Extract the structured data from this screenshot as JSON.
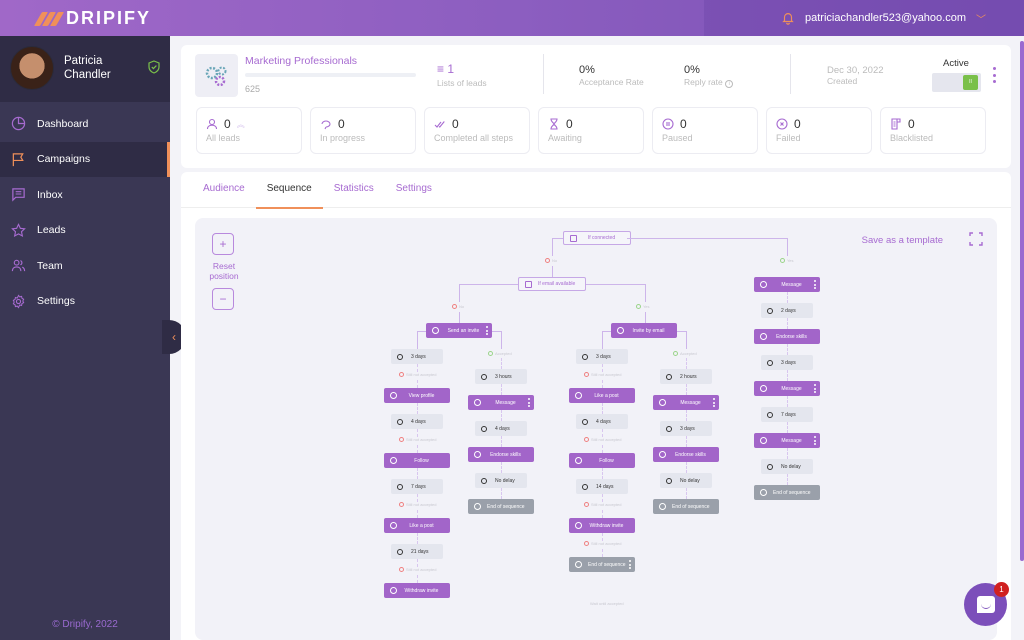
{
  "app": {
    "brand": "DRIPIFY"
  },
  "header": {
    "email": "patriciachandler523@yahoo.com",
    "icons": {
      "bell": "bell-icon",
      "chevron": "chevron-down-icon"
    }
  },
  "sidebar": {
    "user": {
      "first": "Patricia",
      "last": "Chandler"
    },
    "items": [
      {
        "label": "Dashboard",
        "icon": "pie-chart-icon"
      },
      {
        "label": "Campaigns",
        "icon": "flag-icon",
        "active": true
      },
      {
        "label": "Inbox",
        "icon": "message-icon"
      },
      {
        "label": "Leads",
        "icon": "star-icon"
      },
      {
        "label": "Team",
        "icon": "team-icon"
      },
      {
        "label": "Settings",
        "icon": "gear-icon"
      }
    ],
    "copyright": "© Dripify, 2022"
  },
  "campaign": {
    "name": "Marketing Professionals",
    "count": "625",
    "lists_value": "1",
    "lists_label": "Lists of leads",
    "acceptance_value": "0%",
    "acceptance_label": "Acceptance Rate",
    "reply_value": "0%",
    "reply_label": "Reply rate",
    "created_date": "Dec 30, 2022",
    "created_label": "Created",
    "status_label": "Active",
    "status_on": true
  },
  "stats": [
    {
      "value": "0",
      "label": "All leads",
      "icon": "user-icon"
    },
    {
      "value": "0",
      "label": "In progress",
      "icon": "progress-icon"
    },
    {
      "value": "0",
      "label": "Completed all steps",
      "icon": "double-check-icon"
    },
    {
      "value": "0",
      "label": "Awaiting",
      "icon": "hourglass-icon"
    },
    {
      "value": "0",
      "label": "Paused",
      "icon": "pause-icon"
    },
    {
      "value": "0",
      "label": "Failed",
      "icon": "x-circle-icon"
    },
    {
      "value": "0",
      "label": "Blacklisted",
      "icon": "blacklist-icon"
    }
  ],
  "tabs": [
    {
      "label": "Audience"
    },
    {
      "label": "Sequence",
      "active": true
    },
    {
      "label": "Statistics"
    },
    {
      "label": "Settings"
    }
  ],
  "canvas": {
    "zoom_in": "+",
    "zoom_out": "−",
    "reset": "Reset position",
    "save_template": "Save as a template"
  },
  "flow": {
    "if_connected": "If connected",
    "if_email": "If email available",
    "no": "No",
    "yes": "Yes",
    "accepted": "Accepted",
    "still_not_accepted": "Still not accepted",
    "wait_until_accepted": "Wait until accepted",
    "send_invite": "Send an invite",
    "invite_email": "Invite by email",
    "branch_a_left": [
      {
        "type": "delay",
        "text": "3 days"
      },
      {
        "type": "action",
        "text": "View profile",
        "icon": "eye-icon"
      },
      {
        "type": "delay",
        "text": "4 days"
      },
      {
        "type": "action",
        "text": "Follow",
        "icon": "follow-icon"
      },
      {
        "type": "delay",
        "text": "7 days"
      },
      {
        "type": "action",
        "text": "Like a post",
        "icon": "thumbs-up-icon"
      },
      {
        "type": "delay",
        "text": "21 days"
      },
      {
        "type": "action",
        "text": "Withdraw invite",
        "icon": "user-icon"
      }
    ],
    "branch_a_right": [
      {
        "type": "delay",
        "text": "3 hours"
      },
      {
        "type": "action",
        "text": "Message",
        "icon": "message-icon"
      },
      {
        "type": "delay",
        "text": "4 days"
      },
      {
        "type": "action",
        "text": "Endorse skills",
        "icon": "check-circle-icon"
      },
      {
        "type": "delay",
        "text": "No delay"
      },
      {
        "type": "end",
        "text": "End of sequence"
      }
    ],
    "branch_b_left": [
      {
        "type": "delay",
        "text": "3 days"
      },
      {
        "type": "action",
        "text": "Like a post",
        "icon": "thumbs-up-icon"
      },
      {
        "type": "delay",
        "text": "4 days"
      },
      {
        "type": "action",
        "text": "Follow",
        "icon": "follow-icon"
      },
      {
        "type": "delay",
        "text": "14 days"
      },
      {
        "type": "action",
        "text": "Withdraw invite",
        "icon": "user-icon"
      },
      {
        "type": "end",
        "text": "End of sequence"
      }
    ],
    "branch_b_right": [
      {
        "type": "delay",
        "text": "2 hours"
      },
      {
        "type": "action",
        "text": "Message",
        "icon": "message-icon"
      },
      {
        "type": "delay",
        "text": "3 days"
      },
      {
        "type": "action",
        "text": "Endorse skills",
        "icon": "check-circle-icon"
      },
      {
        "type": "delay",
        "text": "No delay"
      },
      {
        "type": "end",
        "text": "End of sequence"
      }
    ],
    "branch_c": [
      {
        "type": "action",
        "text": "Message",
        "icon": "message-icon"
      },
      {
        "type": "delay",
        "text": "2 days"
      },
      {
        "type": "action",
        "text": "Endorse skills",
        "icon": "check-circle-icon"
      },
      {
        "type": "delay",
        "text": "3 days"
      },
      {
        "type": "action",
        "text": "Message",
        "icon": "message-icon"
      },
      {
        "type": "delay",
        "text": "7 days"
      },
      {
        "type": "action",
        "text": "Message",
        "icon": "message-icon"
      },
      {
        "type": "delay",
        "text": "No delay"
      },
      {
        "type": "end",
        "text": "End of sequence"
      }
    ]
  },
  "chat_widget": {
    "badge": "1"
  }
}
